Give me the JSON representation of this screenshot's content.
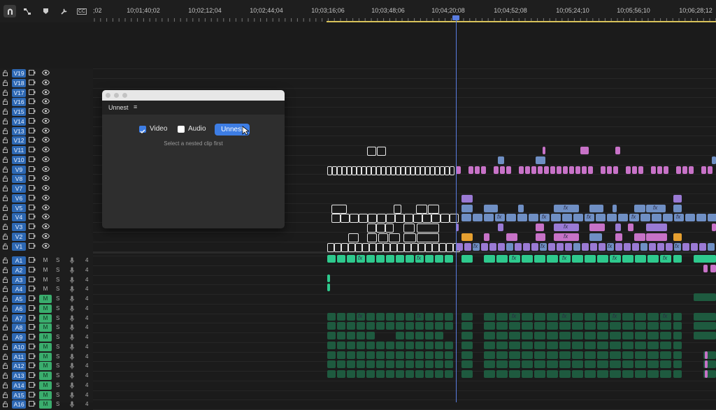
{
  "toolbar": {
    "icons": [
      "magnet-icon",
      "linked-selection-icon",
      "marker-icon",
      "wrench-icon",
      "captions-icon"
    ],
    "captions_label": "CC"
  },
  "ruler": {
    "timecodes": [
      ";02",
      "10;01;40;02",
      "10;02;12;04",
      "10;02;44;04",
      "10;03;16;06",
      "10;03;48;06",
      "10;04;20;08",
      "10;04;52;08",
      "10;05;24;10",
      "10;05;56;10",
      "10;06;28;12"
    ],
    "playhead_timecode": "10;04;20;08"
  },
  "video_tracks": [
    "V19",
    "V18",
    "V17",
    "V16",
    "V15",
    "V14",
    "V13",
    "V12",
    "V11",
    "V10",
    "V9",
    "V8",
    "V7",
    "V6",
    "V5",
    "V4",
    "V3",
    "V2",
    "V1"
  ],
  "audio_tracks": [
    {
      "name": "A1",
      "m": "M",
      "s": "S",
      "vol": "4",
      "muted": false
    },
    {
      "name": "A2",
      "m": "M",
      "s": "S",
      "vol": "4",
      "muted": false
    },
    {
      "name": "A3",
      "m": "M",
      "s": "S",
      "vol": "4",
      "muted": false
    },
    {
      "name": "A4",
      "m": "M",
      "s": "S",
      "vol": "4",
      "muted": false
    },
    {
      "name": "A5",
      "m": "M",
      "s": "S",
      "vol": "4",
      "muted": true
    },
    {
      "name": "A6",
      "m": "M",
      "s": "S",
      "vol": "4",
      "muted": true
    },
    {
      "name": "A7",
      "m": "M",
      "s": "S",
      "vol": "4",
      "muted": true
    },
    {
      "name": "A8",
      "m": "M",
      "s": "S",
      "vol": "4",
      "muted": true
    },
    {
      "name": "A9",
      "m": "M",
      "s": "S",
      "vol": "4",
      "muted": true
    },
    {
      "name": "A10",
      "m": "M",
      "s": "S",
      "vol": "4",
      "muted": true
    },
    {
      "name": "A11",
      "m": "M",
      "s": "S",
      "vol": "4",
      "muted": true
    },
    {
      "name": "A12",
      "m": "M",
      "s": "S",
      "vol": "4",
      "muted": true
    },
    {
      "name": "A13",
      "m": "M",
      "s": "S",
      "vol": "4",
      "muted": true
    },
    {
      "name": "A14",
      "m": "M",
      "s": "S",
      "vol": "4",
      "muted": true
    },
    {
      "name": "A15",
      "m": "M",
      "s": "S",
      "vol": "4",
      "muted": true
    },
    {
      "name": "A16",
      "m": "M",
      "s": "S",
      "vol": "4",
      "muted": true
    }
  ],
  "clip_fx_label": "fx",
  "dialog": {
    "title": "Unnest",
    "menu_icon": "≡",
    "video_label": "Video",
    "video_checked": true,
    "audio_label": "Audio",
    "audio_checked": false,
    "button_label": "Unnest",
    "hint": "Select a nested clip first"
  },
  "colors": {
    "accent": "#3d7de4",
    "track_label": "#2d68b3",
    "mute_on": "#3aad6d",
    "clip_blue": "#6f8fc4",
    "clip_pink": "#c772c7",
    "clip_purple": "#9a7ad4",
    "clip_orange": "#e6a030",
    "clip_audio": "#2ec98d",
    "clip_audio_dark": "#1e5a3f",
    "playhead": "#5a7de0",
    "work_area": "#d8c25a"
  }
}
